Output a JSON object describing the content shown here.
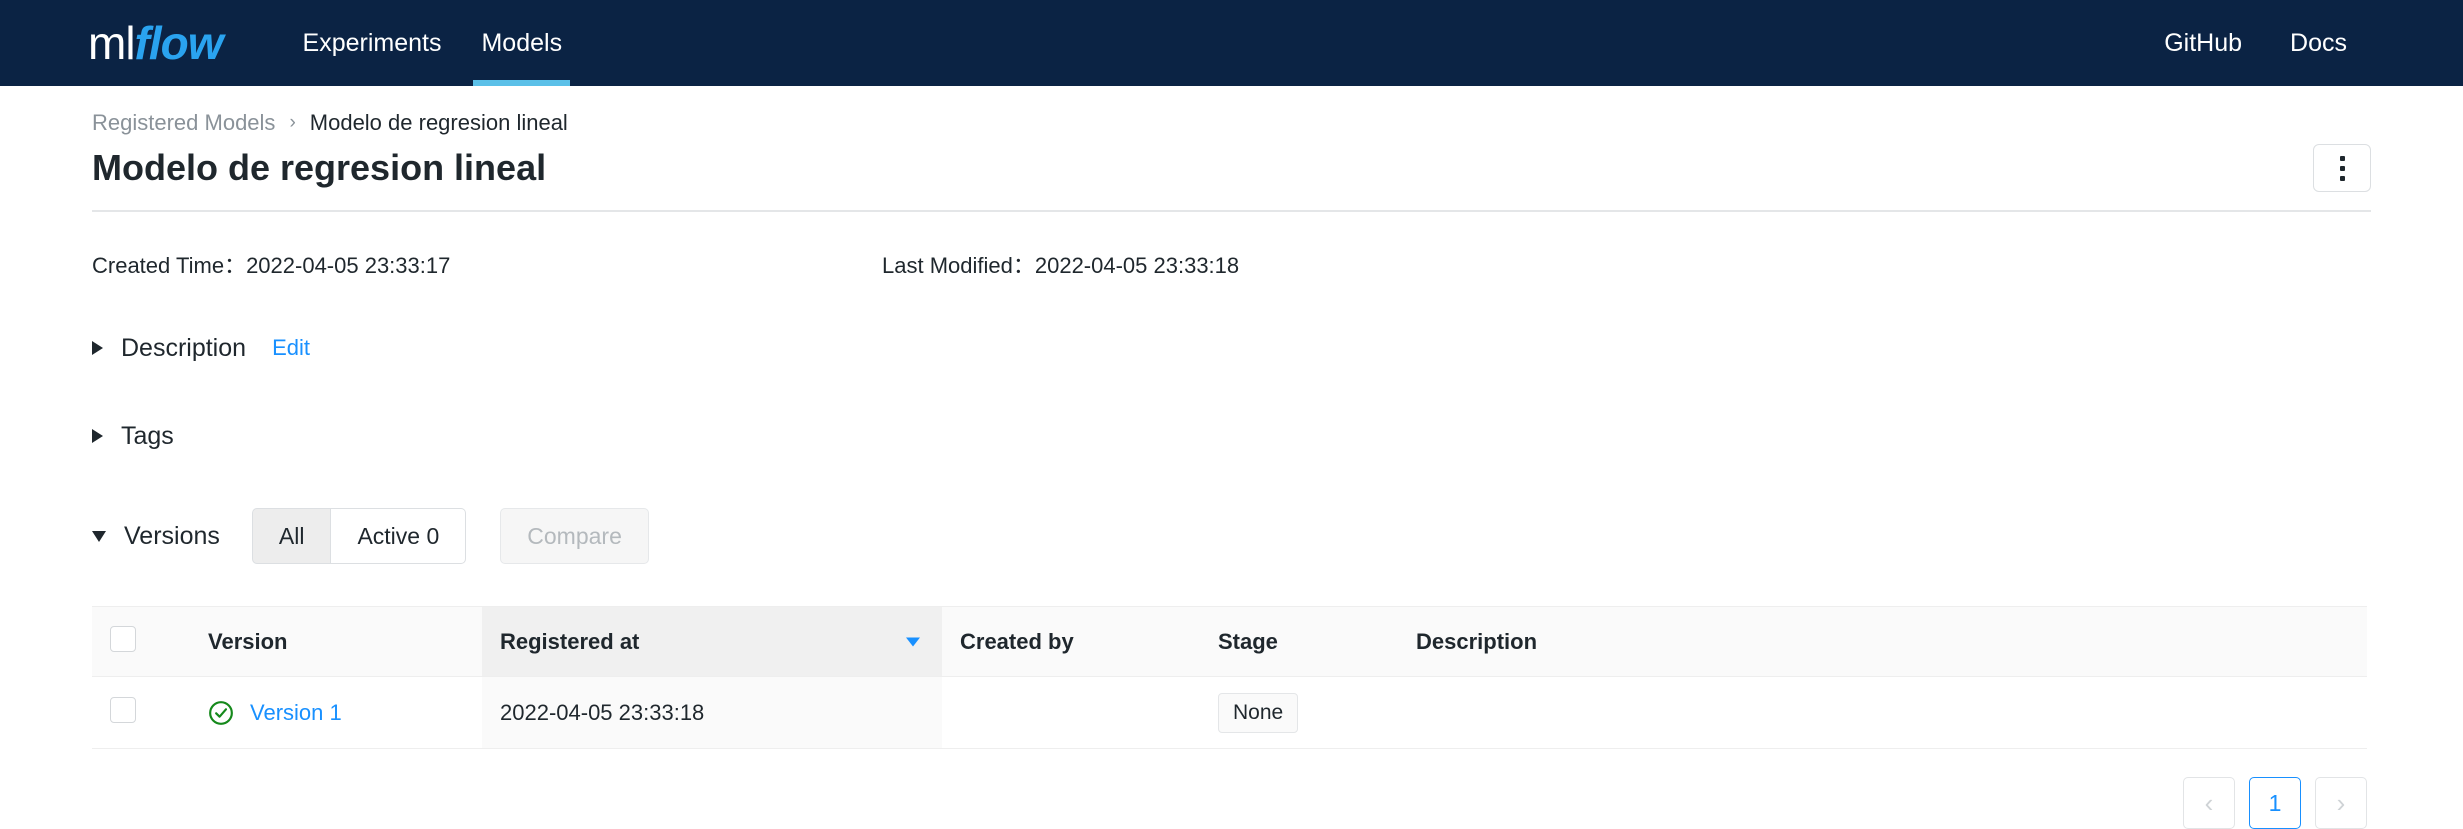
{
  "header": {
    "logo": {
      "part1": "ml",
      "part2": "flow"
    },
    "nav": [
      {
        "label": "Experiments",
        "active": false
      },
      {
        "label": "Models",
        "active": true
      }
    ],
    "nav_right": [
      {
        "label": "GitHub"
      },
      {
        "label": "Docs"
      }
    ],
    "accent_color": "#5bc0e8",
    "background_color": "#0b2344"
  },
  "breadcrumb": {
    "parent": "Registered Models",
    "separator": "›",
    "current": "Modelo de regresion lineal"
  },
  "page": {
    "title": "Modelo de regresion lineal",
    "kebab_menu": "more-actions"
  },
  "meta": {
    "created_label": "Created Time：",
    "created_value": "2022-04-05 23:33:17",
    "modified_label": "Last Modified：",
    "modified_value": "2022-04-05 23:33:18"
  },
  "sections": {
    "description": {
      "title": "Description",
      "edit_label": "Edit",
      "expanded": false
    },
    "tags": {
      "title": "Tags",
      "expanded": false
    },
    "versions": {
      "title": "Versions",
      "expanded": true,
      "filter_all": "All",
      "filter_active": "Active 0",
      "compare_label": "Compare"
    }
  },
  "table": {
    "columns": [
      "Version",
      "Registered at",
      "Created by",
      "Stage",
      "Description"
    ],
    "sorted_column": "Registered at",
    "sort_direction": "descending",
    "rows": [
      {
        "version": "Version 1",
        "registered_at": "2022-04-05 23:33:18",
        "created_by": "",
        "stage": "None",
        "description": "",
        "status": "ready"
      }
    ]
  },
  "pagination": {
    "prev": "‹",
    "current_page": "1",
    "next": "›"
  },
  "colors": {
    "link": "#1890ff",
    "status_ready": "#15891b",
    "muted": "#8a9299"
  }
}
